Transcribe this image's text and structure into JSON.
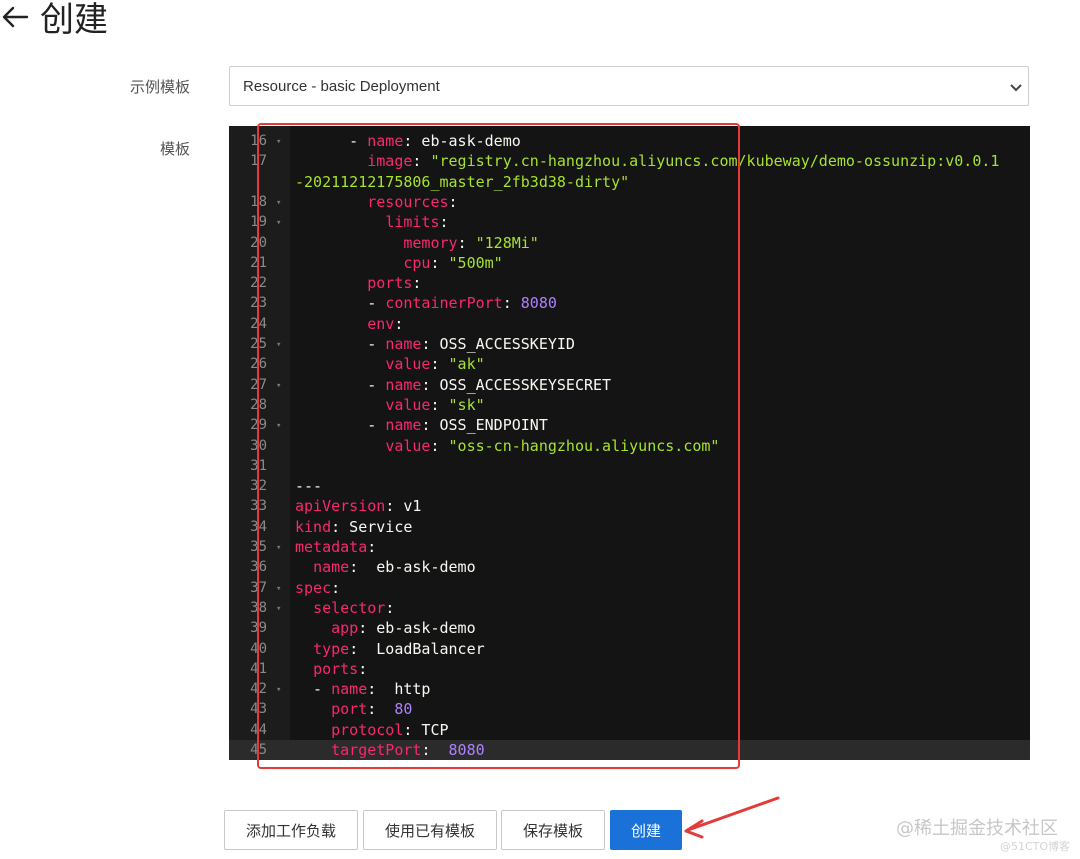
{
  "header": {
    "back_icon": "left-arrow-icon",
    "title": "创建"
  },
  "form": {
    "template_example_label": "示例模板",
    "template_example_value": "Resource - basic Deployment",
    "template_label": "模板"
  },
  "editor": {
    "lines": [
      {
        "n": "16",
        "fold": true,
        "segs": [
          [
            "p",
            "      - "
          ],
          [
            "k",
            "name"
          ],
          [
            "p",
            ": eb-ask-demo"
          ]
        ]
      },
      {
        "n": "17",
        "fold": false,
        "segs": [
          [
            "p",
            "        "
          ],
          [
            "k",
            "image"
          ],
          [
            "p",
            ": "
          ],
          [
            "s",
            "\"registry.cn-hangzhou.aliyuncs.com/kubeway/demo-ossunzip:v0.0.1"
          ]
        ]
      },
      {
        "n": "",
        "fold": false,
        "segs": [
          [
            "s",
            "-20211212175806_master_2fb3d38-dirty\""
          ]
        ]
      },
      {
        "n": "18",
        "fold": true,
        "segs": [
          [
            "p",
            "        "
          ],
          [
            "k",
            "resources"
          ],
          [
            "p",
            ":"
          ]
        ]
      },
      {
        "n": "19",
        "fold": true,
        "segs": [
          [
            "p",
            "          "
          ],
          [
            "k",
            "limits"
          ],
          [
            "p",
            ":"
          ]
        ]
      },
      {
        "n": "20",
        "fold": false,
        "segs": [
          [
            "p",
            "            "
          ],
          [
            "k",
            "memory"
          ],
          [
            "p",
            ": "
          ],
          [
            "s",
            "\"128Mi\""
          ]
        ]
      },
      {
        "n": "21",
        "fold": false,
        "segs": [
          [
            "p",
            "            "
          ],
          [
            "k",
            "cpu"
          ],
          [
            "p",
            ": "
          ],
          [
            "s",
            "\"500m\""
          ]
        ]
      },
      {
        "n": "22",
        "fold": false,
        "segs": [
          [
            "p",
            "        "
          ],
          [
            "k",
            "ports"
          ],
          [
            "p",
            ":"
          ]
        ]
      },
      {
        "n": "23",
        "fold": false,
        "segs": [
          [
            "p",
            "        - "
          ],
          [
            "k",
            "containerPort"
          ],
          [
            "p",
            ": "
          ],
          [
            "n",
            "8080"
          ]
        ]
      },
      {
        "n": "24",
        "fold": false,
        "segs": [
          [
            "p",
            "        "
          ],
          [
            "k",
            "env"
          ],
          [
            "p",
            ":"
          ]
        ]
      },
      {
        "n": "25",
        "fold": true,
        "segs": [
          [
            "p",
            "        - "
          ],
          [
            "k",
            "name"
          ],
          [
            "p",
            ": OSS_ACCESSKEYID"
          ]
        ]
      },
      {
        "n": "26",
        "fold": false,
        "segs": [
          [
            "p",
            "          "
          ],
          [
            "k",
            "value"
          ],
          [
            "p",
            ": "
          ],
          [
            "s",
            "\"ak\""
          ]
        ]
      },
      {
        "n": "27",
        "fold": true,
        "segs": [
          [
            "p",
            "        - "
          ],
          [
            "k",
            "name"
          ],
          [
            "p",
            ": OSS_ACCESSKEYSECRET"
          ]
        ]
      },
      {
        "n": "28",
        "fold": false,
        "segs": [
          [
            "p",
            "          "
          ],
          [
            "k",
            "value"
          ],
          [
            "p",
            ": "
          ],
          [
            "s",
            "\"sk\""
          ]
        ]
      },
      {
        "n": "29",
        "fold": true,
        "segs": [
          [
            "p",
            "        - "
          ],
          [
            "k",
            "name"
          ],
          [
            "p",
            ": OSS_ENDPOINT"
          ]
        ]
      },
      {
        "n": "30",
        "fold": false,
        "segs": [
          [
            "p",
            "          "
          ],
          [
            "k",
            "value"
          ],
          [
            "p",
            ": "
          ],
          [
            "s",
            "\"oss-cn-hangzhou.aliyuncs.com\""
          ]
        ]
      },
      {
        "n": "31",
        "fold": false,
        "segs": []
      },
      {
        "n": "32",
        "fold": false,
        "segs": [
          [
            "p",
            "---"
          ]
        ]
      },
      {
        "n": "33",
        "fold": false,
        "segs": [
          [
            "k",
            "apiVersion"
          ],
          [
            "p",
            ": v1"
          ]
        ]
      },
      {
        "n": "34",
        "fold": false,
        "segs": [
          [
            "k",
            "kind"
          ],
          [
            "p",
            ": Service"
          ]
        ]
      },
      {
        "n": "35",
        "fold": true,
        "segs": [
          [
            "k",
            "metadata"
          ],
          [
            "p",
            ":"
          ]
        ]
      },
      {
        "n": "36",
        "fold": false,
        "segs": [
          [
            "p",
            "  "
          ],
          [
            "k",
            "name"
          ],
          [
            "p",
            ":  eb-ask-demo"
          ]
        ]
      },
      {
        "n": "37",
        "fold": true,
        "segs": [
          [
            "k",
            "spec"
          ],
          [
            "p",
            ":"
          ]
        ]
      },
      {
        "n": "38",
        "fold": true,
        "segs": [
          [
            "p",
            "  "
          ],
          [
            "k",
            "selector"
          ],
          [
            "p",
            ":"
          ]
        ]
      },
      {
        "n": "39",
        "fold": false,
        "segs": [
          [
            "p",
            "    "
          ],
          [
            "k",
            "app"
          ],
          [
            "p",
            ": eb-ask-demo"
          ]
        ]
      },
      {
        "n": "40",
        "fold": false,
        "segs": [
          [
            "p",
            "  "
          ],
          [
            "k",
            "type"
          ],
          [
            "p",
            ":  LoadBalancer"
          ]
        ]
      },
      {
        "n": "41",
        "fold": false,
        "segs": [
          [
            "p",
            "  "
          ],
          [
            "k",
            "ports"
          ],
          [
            "p",
            ":"
          ]
        ]
      },
      {
        "n": "42",
        "fold": true,
        "segs": [
          [
            "p",
            "  - "
          ],
          [
            "k",
            "name"
          ],
          [
            "p",
            ":  http"
          ]
        ]
      },
      {
        "n": "43",
        "fold": false,
        "segs": [
          [
            "p",
            "    "
          ],
          [
            "k",
            "port"
          ],
          [
            "p",
            ":  "
          ],
          [
            "n",
            "80"
          ]
        ]
      },
      {
        "n": "44",
        "fold": false,
        "segs": [
          [
            "p",
            "    "
          ],
          [
            "k",
            "protocol"
          ],
          [
            "p",
            ": TCP"
          ]
        ]
      },
      {
        "n": "45",
        "fold": false,
        "active": true,
        "segs": [
          [
            "p",
            "    "
          ],
          [
            "k",
            "targetPort"
          ],
          [
            "p",
            ":  "
          ],
          [
            "n",
            "8080"
          ]
        ]
      }
    ]
  },
  "actions": {
    "add_workload": "添加工作负载",
    "use_existing_template": "使用已有模板",
    "save_template": "保存模板",
    "create": "创建"
  },
  "watermark": {
    "text": "@稀土掘金技术社区",
    "sub": "@51CTO博客"
  },
  "colors": {
    "primary": "#1a71d8",
    "annotation_red": "#e53a3a",
    "editor_bg": "#141414"
  }
}
